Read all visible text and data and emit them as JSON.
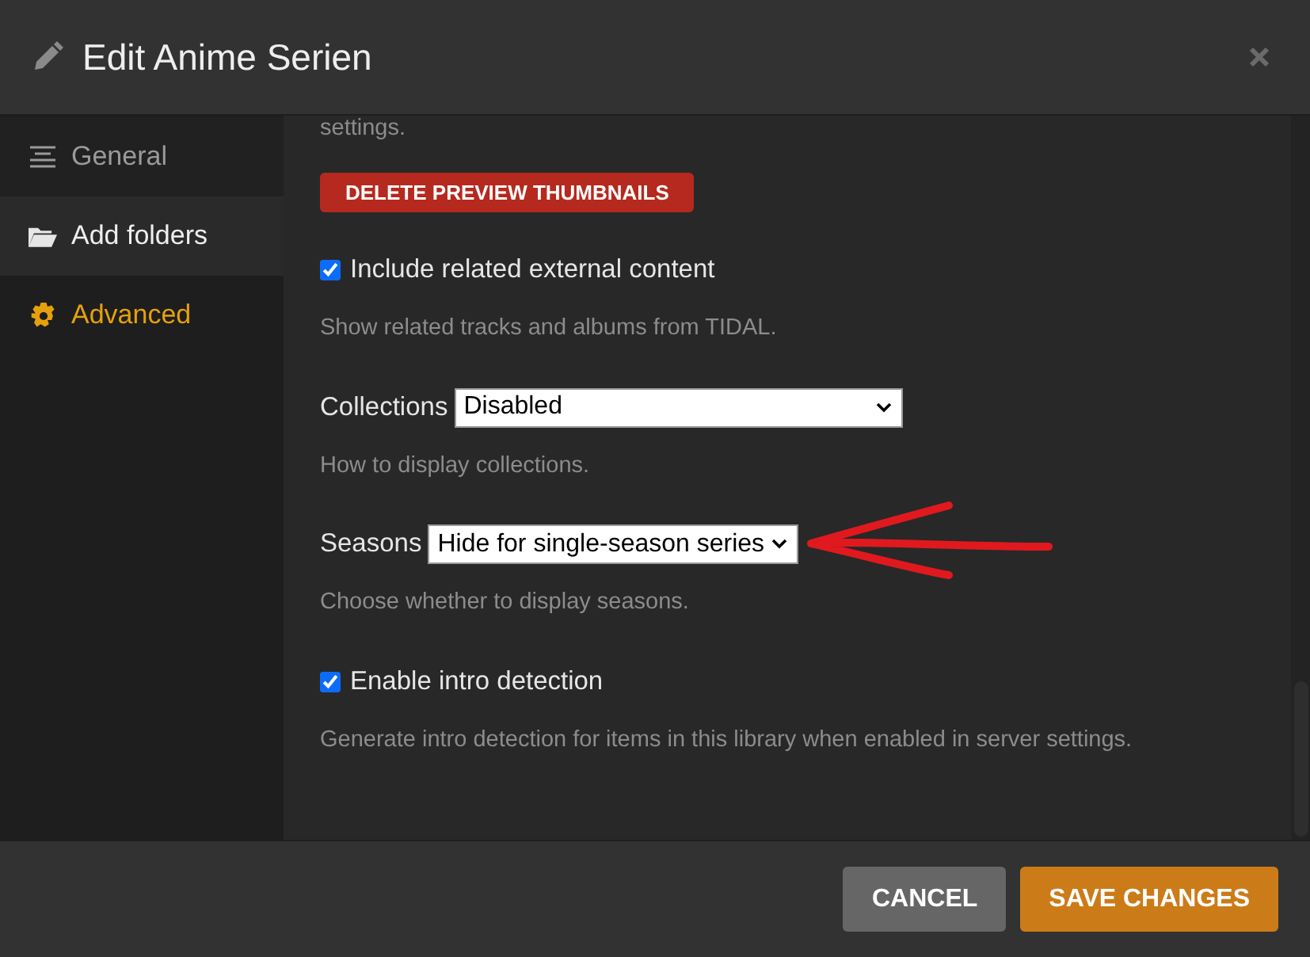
{
  "dialog": {
    "title": "Edit Anime Serien"
  },
  "sidebar": {
    "items": [
      {
        "label": "General",
        "kind": "lines",
        "selected": false,
        "highlighted": false
      },
      {
        "label": "Add folders",
        "kind": "folder",
        "selected": false,
        "highlighted": true
      },
      {
        "label": "Advanced",
        "kind": "gear",
        "selected": true,
        "highlighted": false
      }
    ]
  },
  "settings": [
    {
      "kind": "note",
      "text": "settings."
    },
    {
      "kind": "button",
      "label": "DELETE PREVIEW THUMBNAILS"
    },
    {
      "kind": "checkbox",
      "label": "Include related external content",
      "checked": true,
      "help": "Show related tracks and albums from TIDAL."
    },
    {
      "kind": "select",
      "label": "Collections",
      "value": "Disabled",
      "wide": true,
      "help": "How to display collections."
    },
    {
      "kind": "select",
      "label": "Seasons",
      "value": "Hide for single-season series",
      "wide": false,
      "help": "Choose whether to display seasons.",
      "annotated": true
    },
    {
      "kind": "checkbox",
      "label": "Enable intro detection",
      "checked": true,
      "help": "Generate intro detection for items in this library when enabled in server settings."
    }
  ],
  "footer": {
    "buttons": [
      {
        "label": "CANCEL",
        "kind": "secondary"
      },
      {
        "label": "SAVE CHANGES",
        "kind": "primary"
      }
    ]
  }
}
